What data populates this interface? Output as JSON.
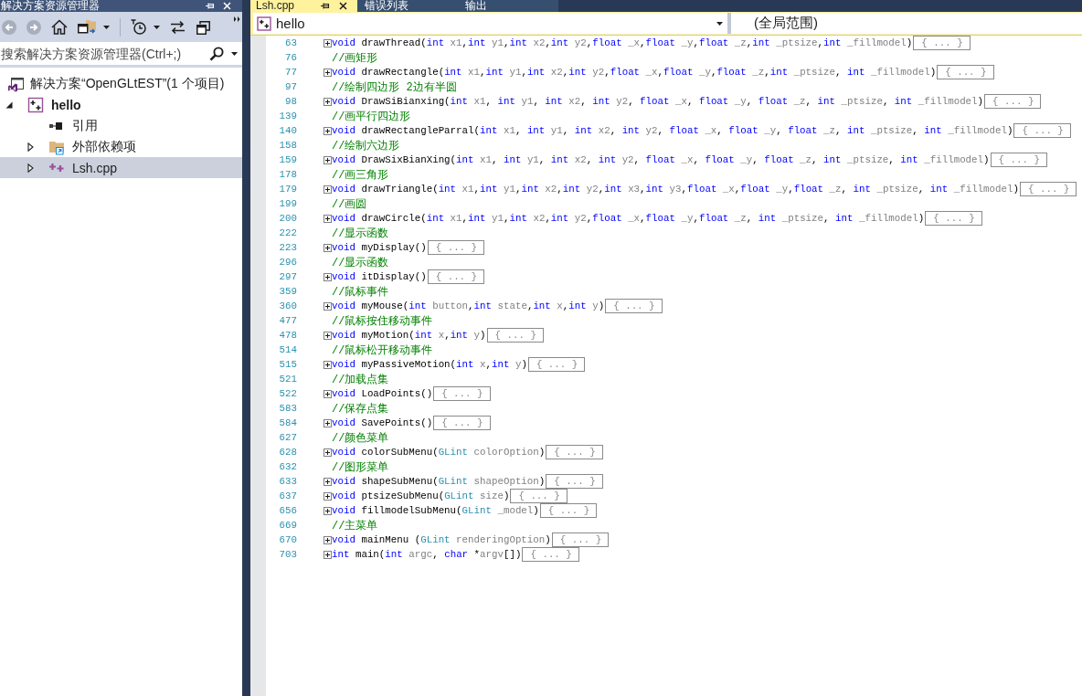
{
  "explorer": {
    "title": "解决方案资源管理器",
    "toolbar": [
      {
        "kind": "back",
        "disabled": true,
        "dropdown": false
      },
      {
        "kind": "forward",
        "disabled": true,
        "dropdown": false
      },
      {
        "kind": "home",
        "disabled": false,
        "dropdown": false
      },
      {
        "kind": "views",
        "disabled": false,
        "dropdown": true
      },
      {
        "kind": "separator"
      },
      {
        "kind": "history",
        "disabled": false,
        "dropdown": true
      },
      {
        "kind": "sync",
        "disabled": false,
        "dropdown": false
      },
      {
        "kind": "collapse",
        "disabled": false,
        "dropdown": false
      }
    ],
    "search": {
      "placeholder": "搜索解决方案资源管理器(Ctrl+;)"
    },
    "tree": [
      {
        "label": "解决方案“OpenGLtEST”(1 个项目)",
        "kind": "solution",
        "selected": false,
        "children": [
          {
            "label": "hello",
            "kind": "project",
            "startup": true,
            "expanded": true,
            "selected": false,
            "children": [
              {
                "label": "引用",
                "kind": "references",
                "selected": false
              },
              {
                "label": "外部依赖项",
                "kind": "dependencies",
                "expanded": false,
                "selected": false
              },
              {
                "label": "Lsh.cpp",
                "kind": "source",
                "expanded": false,
                "selected": true
              }
            ]
          }
        ]
      }
    ]
  },
  "editor": {
    "tabs": [
      {
        "label": "Lsh.cpp",
        "selected": true
      },
      {
        "label": "错误列表",
        "selected": false
      },
      {
        "label": "输出",
        "selected": false
      }
    ],
    "navigation": {
      "project": "hello",
      "scope": "(全局范围)"
    },
    "lines": [
      {
        "number": "63",
        "kind": "declaration",
        "expanded": false,
        "tokens": [
          {
            "kind": "keyword",
            "text": "void"
          },
          {
            "kind": "plain",
            "text": " drawThread("
          },
          {
            "kind": "keyword",
            "text": "int"
          },
          {
            "kind": "param",
            "text": " x1"
          },
          {
            "kind": "plain",
            "text": ","
          },
          {
            "kind": "keyword",
            "text": "int"
          },
          {
            "kind": "param",
            "text": " y1"
          },
          {
            "kind": "plain",
            "text": ","
          },
          {
            "kind": "keyword",
            "text": "int"
          },
          {
            "kind": "param",
            "text": " x2"
          },
          {
            "kind": "plain",
            "text": ","
          },
          {
            "kind": "keyword",
            "text": "int"
          },
          {
            "kind": "param",
            "text": " y2"
          },
          {
            "kind": "plain",
            "text": ","
          },
          {
            "kind": "keyword",
            "text": "float"
          },
          {
            "kind": "param",
            "text": " _x"
          },
          {
            "kind": "plain",
            "text": ","
          },
          {
            "kind": "keyword",
            "text": "float"
          },
          {
            "kind": "param",
            "text": " _y"
          },
          {
            "kind": "plain",
            "text": ","
          },
          {
            "kind": "keyword",
            "text": "float"
          },
          {
            "kind": "param",
            "text": " _z"
          },
          {
            "kind": "plain",
            "text": ","
          },
          {
            "kind": "keyword",
            "text": "int"
          },
          {
            "kind": "param",
            "text": " _ptsize"
          },
          {
            "kind": "plain",
            "text": ","
          },
          {
            "kind": "keyword",
            "text": "int"
          },
          {
            "kind": "param",
            "text": " _fillmodel"
          },
          {
            "kind": "plain",
            "text": ")"
          }
        ],
        "collapsed": "{ ... }"
      },
      {
        "number": "76",
        "kind": "comment",
        "text": "//画矩形"
      },
      {
        "number": "77",
        "kind": "declaration",
        "expanded": false,
        "tokens": [
          {
            "kind": "keyword",
            "text": "void"
          },
          {
            "kind": "plain",
            "text": " drawRectangle("
          },
          {
            "kind": "keyword",
            "text": "int"
          },
          {
            "kind": "param",
            "text": " x1"
          },
          {
            "kind": "plain",
            "text": ","
          },
          {
            "kind": "keyword",
            "text": "int"
          },
          {
            "kind": "param",
            "text": " y1"
          },
          {
            "kind": "plain",
            "text": ","
          },
          {
            "kind": "keyword",
            "text": "int"
          },
          {
            "kind": "param",
            "text": " x2"
          },
          {
            "kind": "plain",
            "text": ","
          },
          {
            "kind": "keyword",
            "text": "int"
          },
          {
            "kind": "param",
            "text": " y2"
          },
          {
            "kind": "plain",
            "text": ","
          },
          {
            "kind": "keyword",
            "text": "float"
          },
          {
            "kind": "param",
            "text": " _x"
          },
          {
            "kind": "plain",
            "text": ","
          },
          {
            "kind": "keyword",
            "text": "float"
          },
          {
            "kind": "param",
            "text": " _y"
          },
          {
            "kind": "plain",
            "text": ","
          },
          {
            "kind": "keyword",
            "text": "float"
          },
          {
            "kind": "param",
            "text": " _z"
          },
          {
            "kind": "plain",
            "text": ","
          },
          {
            "kind": "keyword",
            "text": "int"
          },
          {
            "kind": "param",
            "text": " _ptsize"
          },
          {
            "kind": "plain",
            "text": ", "
          },
          {
            "kind": "keyword",
            "text": "int"
          },
          {
            "kind": "param",
            "text": " _fillmodel"
          },
          {
            "kind": "plain",
            "text": ")"
          }
        ],
        "collapsed": "{ ... }"
      },
      {
        "number": "97",
        "kind": "comment",
        "text": "//绘制四边形 2边有半圆"
      },
      {
        "number": "98",
        "kind": "declaration",
        "expanded": false,
        "tokens": [
          {
            "kind": "keyword",
            "text": "void"
          },
          {
            "kind": "plain",
            "text": " DrawSiBianxing("
          },
          {
            "kind": "keyword",
            "text": "int"
          },
          {
            "kind": "param",
            "text": " x1"
          },
          {
            "kind": "plain",
            "text": ", "
          },
          {
            "kind": "keyword",
            "text": "int"
          },
          {
            "kind": "param",
            "text": " y1"
          },
          {
            "kind": "plain",
            "text": ", "
          },
          {
            "kind": "keyword",
            "text": "int"
          },
          {
            "kind": "param",
            "text": " x2"
          },
          {
            "kind": "plain",
            "text": ", "
          },
          {
            "kind": "keyword",
            "text": "int"
          },
          {
            "kind": "param",
            "text": " y2"
          },
          {
            "kind": "plain",
            "text": ", "
          },
          {
            "kind": "keyword",
            "text": "float"
          },
          {
            "kind": "param",
            "text": " _x"
          },
          {
            "kind": "plain",
            "text": ", "
          },
          {
            "kind": "keyword",
            "text": "float"
          },
          {
            "kind": "param",
            "text": " _y"
          },
          {
            "kind": "plain",
            "text": ", "
          },
          {
            "kind": "keyword",
            "text": "float"
          },
          {
            "kind": "param",
            "text": " _z"
          },
          {
            "kind": "plain",
            "text": ", "
          },
          {
            "kind": "keyword",
            "text": "int"
          },
          {
            "kind": "param",
            "text": " _ptsize"
          },
          {
            "kind": "plain",
            "text": ", "
          },
          {
            "kind": "keyword",
            "text": "int"
          },
          {
            "kind": "param",
            "text": " _fillmodel"
          },
          {
            "kind": "plain",
            "text": ")"
          }
        ],
        "collapsed": "{ ... }"
      },
      {
        "number": "139",
        "kind": "comment",
        "text": "//画平行四边形"
      },
      {
        "number": "140",
        "kind": "declaration",
        "expanded": false,
        "tokens": [
          {
            "kind": "keyword",
            "text": "void"
          },
          {
            "kind": "plain",
            "text": " drawRectangleParral("
          },
          {
            "kind": "keyword",
            "text": "int"
          },
          {
            "kind": "param",
            "text": " x1"
          },
          {
            "kind": "plain",
            "text": ", "
          },
          {
            "kind": "keyword",
            "text": "int"
          },
          {
            "kind": "param",
            "text": " y1"
          },
          {
            "kind": "plain",
            "text": ", "
          },
          {
            "kind": "keyword",
            "text": "int"
          },
          {
            "kind": "param",
            "text": " x2"
          },
          {
            "kind": "plain",
            "text": ", "
          },
          {
            "kind": "keyword",
            "text": "int"
          },
          {
            "kind": "param",
            "text": " y2"
          },
          {
            "kind": "plain",
            "text": ", "
          },
          {
            "kind": "keyword",
            "text": "float"
          },
          {
            "kind": "param",
            "text": " _x"
          },
          {
            "kind": "plain",
            "text": ", "
          },
          {
            "kind": "keyword",
            "text": "float"
          },
          {
            "kind": "param",
            "text": " _y"
          },
          {
            "kind": "plain",
            "text": ", "
          },
          {
            "kind": "keyword",
            "text": "float"
          },
          {
            "kind": "param",
            "text": " _z"
          },
          {
            "kind": "plain",
            "text": ", "
          },
          {
            "kind": "keyword",
            "text": "int"
          },
          {
            "kind": "param",
            "text": " _ptsize"
          },
          {
            "kind": "plain",
            "text": ", "
          },
          {
            "kind": "keyword",
            "text": "int"
          },
          {
            "kind": "param",
            "text": " _fillmodel"
          },
          {
            "kind": "plain",
            "text": ")"
          }
        ],
        "collapsed": "{ ... }"
      },
      {
        "number": "158",
        "kind": "comment",
        "text": "//绘制六边形"
      },
      {
        "number": "159",
        "kind": "declaration",
        "expanded": false,
        "tokens": [
          {
            "kind": "keyword",
            "text": "void"
          },
          {
            "kind": "plain",
            "text": " DrawSixBianXing("
          },
          {
            "kind": "keyword",
            "text": "int"
          },
          {
            "kind": "param",
            "text": " x1"
          },
          {
            "kind": "plain",
            "text": ", "
          },
          {
            "kind": "keyword",
            "text": "int"
          },
          {
            "kind": "param",
            "text": " y1"
          },
          {
            "kind": "plain",
            "text": ", "
          },
          {
            "kind": "keyword",
            "text": "int"
          },
          {
            "kind": "param",
            "text": " x2"
          },
          {
            "kind": "plain",
            "text": ", "
          },
          {
            "kind": "keyword",
            "text": "int"
          },
          {
            "kind": "param",
            "text": " y2"
          },
          {
            "kind": "plain",
            "text": ", "
          },
          {
            "kind": "keyword",
            "text": "float"
          },
          {
            "kind": "param",
            "text": " _x"
          },
          {
            "kind": "plain",
            "text": ", "
          },
          {
            "kind": "keyword",
            "text": "float"
          },
          {
            "kind": "param",
            "text": " _y"
          },
          {
            "kind": "plain",
            "text": ", "
          },
          {
            "kind": "keyword",
            "text": "float"
          },
          {
            "kind": "param",
            "text": " _z"
          },
          {
            "kind": "plain",
            "text": ", "
          },
          {
            "kind": "keyword",
            "text": "int"
          },
          {
            "kind": "param",
            "text": " _ptsize"
          },
          {
            "kind": "plain",
            "text": ", "
          },
          {
            "kind": "keyword",
            "text": "int"
          },
          {
            "kind": "param",
            "text": " _fillmodel"
          },
          {
            "kind": "plain",
            "text": ")"
          }
        ],
        "collapsed": "{ ... }"
      },
      {
        "number": "178",
        "kind": "comment",
        "text": "//画三角形"
      },
      {
        "number": "179",
        "kind": "declaration",
        "expanded": false,
        "tokens": [
          {
            "kind": "keyword",
            "text": "void"
          },
          {
            "kind": "plain",
            "text": " drawTriangle("
          },
          {
            "kind": "keyword",
            "text": "int"
          },
          {
            "kind": "param",
            "text": " x1"
          },
          {
            "kind": "plain",
            "text": ","
          },
          {
            "kind": "keyword",
            "text": "int"
          },
          {
            "kind": "param",
            "text": " y1"
          },
          {
            "kind": "plain",
            "text": ","
          },
          {
            "kind": "keyword",
            "text": "int"
          },
          {
            "kind": "param",
            "text": " x2"
          },
          {
            "kind": "plain",
            "text": ","
          },
          {
            "kind": "keyword",
            "text": "int"
          },
          {
            "kind": "param",
            "text": " y2"
          },
          {
            "kind": "plain",
            "text": ","
          },
          {
            "kind": "keyword",
            "text": "int"
          },
          {
            "kind": "param",
            "text": " x3"
          },
          {
            "kind": "plain",
            "text": ","
          },
          {
            "kind": "keyword",
            "text": "int"
          },
          {
            "kind": "param",
            "text": " y3"
          },
          {
            "kind": "plain",
            "text": ","
          },
          {
            "kind": "keyword",
            "text": "float"
          },
          {
            "kind": "param",
            "text": " _x"
          },
          {
            "kind": "plain",
            "text": ","
          },
          {
            "kind": "keyword",
            "text": "float"
          },
          {
            "kind": "param",
            "text": " _y"
          },
          {
            "kind": "plain",
            "text": ","
          },
          {
            "kind": "keyword",
            "text": "float"
          },
          {
            "kind": "param",
            "text": " _z"
          },
          {
            "kind": "plain",
            "text": ", "
          },
          {
            "kind": "keyword",
            "text": "int"
          },
          {
            "kind": "param",
            "text": " _ptsize"
          },
          {
            "kind": "plain",
            "text": ", "
          },
          {
            "kind": "keyword",
            "text": "int"
          },
          {
            "kind": "param",
            "text": " _fillmodel"
          },
          {
            "kind": "plain",
            "text": ")"
          }
        ],
        "collapsed": "{ ... }"
      },
      {
        "number": "199",
        "kind": "comment",
        "text": "//画圆"
      },
      {
        "number": "200",
        "kind": "declaration",
        "expanded": false,
        "tokens": [
          {
            "kind": "keyword",
            "text": "void"
          },
          {
            "kind": "plain",
            "text": " drawCircle("
          },
          {
            "kind": "keyword",
            "text": "int"
          },
          {
            "kind": "param",
            "text": " x1"
          },
          {
            "kind": "plain",
            "text": ","
          },
          {
            "kind": "keyword",
            "text": "int"
          },
          {
            "kind": "param",
            "text": " y1"
          },
          {
            "kind": "plain",
            "text": ","
          },
          {
            "kind": "keyword",
            "text": "int"
          },
          {
            "kind": "param",
            "text": " x2"
          },
          {
            "kind": "plain",
            "text": ","
          },
          {
            "kind": "keyword",
            "text": "int"
          },
          {
            "kind": "param",
            "text": " y2"
          },
          {
            "kind": "plain",
            "text": ","
          },
          {
            "kind": "keyword",
            "text": "float"
          },
          {
            "kind": "param",
            "text": " _x"
          },
          {
            "kind": "plain",
            "text": ","
          },
          {
            "kind": "keyword",
            "text": "float"
          },
          {
            "kind": "param",
            "text": " _y"
          },
          {
            "kind": "plain",
            "text": ","
          },
          {
            "kind": "keyword",
            "text": "float"
          },
          {
            "kind": "param",
            "text": " _z"
          },
          {
            "kind": "plain",
            "text": ", "
          },
          {
            "kind": "keyword",
            "text": "int"
          },
          {
            "kind": "param",
            "text": " _ptsize"
          },
          {
            "kind": "plain",
            "text": ", "
          },
          {
            "kind": "keyword",
            "text": "int"
          },
          {
            "kind": "param",
            "text": " _fillmodel"
          },
          {
            "kind": "plain",
            "text": ")"
          }
        ],
        "collapsed": "{ ... }"
      },
      {
        "number": "222",
        "kind": "comment",
        "text": "//显示函数"
      },
      {
        "number": "223",
        "kind": "declaration",
        "expanded": false,
        "tokens": [
          {
            "kind": "keyword",
            "text": "void"
          },
          {
            "kind": "plain",
            "text": " myDisplay()"
          }
        ],
        "collapsed": "{ ... }"
      },
      {
        "number": "296",
        "kind": "comment",
        "text": "//显示函数"
      },
      {
        "number": "297",
        "kind": "declaration",
        "expanded": false,
        "tokens": [
          {
            "kind": "keyword",
            "text": "void"
          },
          {
            "kind": "plain",
            "text": " itDisplay()"
          }
        ],
        "collapsed": "{ ... }"
      },
      {
        "number": "359",
        "kind": "comment",
        "text": "//鼠标事件"
      },
      {
        "number": "360",
        "kind": "declaration",
        "expanded": false,
        "tokens": [
          {
            "kind": "keyword",
            "text": "void"
          },
          {
            "kind": "plain",
            "text": " myMouse("
          },
          {
            "kind": "keyword",
            "text": "int"
          },
          {
            "kind": "param",
            "text": " button"
          },
          {
            "kind": "plain",
            "text": ","
          },
          {
            "kind": "keyword",
            "text": "int"
          },
          {
            "kind": "param",
            "text": " state"
          },
          {
            "kind": "plain",
            "text": ","
          },
          {
            "kind": "keyword",
            "text": "int"
          },
          {
            "kind": "param",
            "text": " x"
          },
          {
            "kind": "plain",
            "text": ","
          },
          {
            "kind": "keyword",
            "text": "int"
          },
          {
            "kind": "param",
            "text": " y"
          },
          {
            "kind": "plain",
            "text": ")"
          }
        ],
        "collapsed": "{ ... }"
      },
      {
        "number": "477",
        "kind": "comment",
        "text": "//鼠标按住移动事件"
      },
      {
        "number": "478",
        "kind": "declaration",
        "expanded": false,
        "tokens": [
          {
            "kind": "keyword",
            "text": "void"
          },
          {
            "kind": "plain",
            "text": " myMotion("
          },
          {
            "kind": "keyword",
            "text": "int"
          },
          {
            "kind": "param",
            "text": " x"
          },
          {
            "kind": "plain",
            "text": ","
          },
          {
            "kind": "keyword",
            "text": "int"
          },
          {
            "kind": "param",
            "text": " y"
          },
          {
            "kind": "plain",
            "text": ")"
          }
        ],
        "collapsed": "{ ... }"
      },
      {
        "number": "514",
        "kind": "comment",
        "text": "//鼠标松开移动事件"
      },
      {
        "number": "515",
        "kind": "declaration",
        "expanded": false,
        "tokens": [
          {
            "kind": "keyword",
            "text": "void"
          },
          {
            "kind": "plain",
            "text": " myPassiveMotion("
          },
          {
            "kind": "keyword",
            "text": "int"
          },
          {
            "kind": "param",
            "text": " x"
          },
          {
            "kind": "plain",
            "text": ","
          },
          {
            "kind": "keyword",
            "text": "int"
          },
          {
            "kind": "param",
            "text": " y"
          },
          {
            "kind": "plain",
            "text": ")"
          }
        ],
        "collapsed": "{ ... }"
      },
      {
        "number": "521",
        "kind": "comment",
        "text": "//加载点集"
      },
      {
        "number": "522",
        "kind": "declaration",
        "expanded": false,
        "tokens": [
          {
            "kind": "keyword",
            "text": "void"
          },
          {
            "kind": "plain",
            "text": " LoadPoints()"
          }
        ],
        "collapsed": "{ ... }"
      },
      {
        "number": "583",
        "kind": "comment",
        "text": "//保存点集"
      },
      {
        "number": "584",
        "kind": "declaration",
        "expanded": false,
        "tokens": [
          {
            "kind": "keyword",
            "text": "void"
          },
          {
            "kind": "plain",
            "text": " SavePoints()"
          }
        ],
        "collapsed": "{ ... }"
      },
      {
        "number": "627",
        "kind": "comment",
        "text": "//颜色菜单"
      },
      {
        "number": "628",
        "kind": "declaration",
        "expanded": false,
        "tokens": [
          {
            "kind": "keyword",
            "text": "void"
          },
          {
            "kind": "plain",
            "text": " colorSubMenu("
          },
          {
            "kind": "type",
            "text": "GLint"
          },
          {
            "kind": "param",
            "text": " colorOption"
          },
          {
            "kind": "plain",
            "text": ")"
          }
        ],
        "collapsed": "{ ... }"
      },
      {
        "number": "632",
        "kind": "comment",
        "text": "//图形菜单"
      },
      {
        "number": "633",
        "kind": "declaration",
        "expanded": false,
        "tokens": [
          {
            "kind": "keyword",
            "text": "void"
          },
          {
            "kind": "plain",
            "text": " shapeSubMenu("
          },
          {
            "kind": "type",
            "text": "GLint"
          },
          {
            "kind": "param",
            "text": " shapeOption"
          },
          {
            "kind": "plain",
            "text": ")"
          }
        ],
        "collapsed": "{ ... }"
      },
      {
        "number": "637",
        "kind": "declaration",
        "expanded": false,
        "tokens": [
          {
            "kind": "keyword",
            "text": "void"
          },
          {
            "kind": "plain",
            "text": " ptsizeSubMenu("
          },
          {
            "kind": "type",
            "text": "GLint"
          },
          {
            "kind": "param",
            "text": " size"
          },
          {
            "kind": "plain",
            "text": ")"
          }
        ],
        "collapsed": "{ ... }"
      },
      {
        "number": "656",
        "kind": "declaration",
        "expanded": false,
        "tokens": [
          {
            "kind": "keyword",
            "text": "void"
          },
          {
            "kind": "plain",
            "text": " fillmodelSubMenu("
          },
          {
            "kind": "type",
            "text": "GLint"
          },
          {
            "kind": "param",
            "text": " _model"
          },
          {
            "kind": "plain",
            "text": ")"
          }
        ],
        "collapsed": "{ ... }"
      },
      {
        "number": "669",
        "kind": "comment",
        "text": "//主菜单"
      },
      {
        "number": "670",
        "kind": "declaration",
        "expanded": false,
        "tokens": [
          {
            "kind": "keyword",
            "text": "void"
          },
          {
            "kind": "plain",
            "text": " mainMenu ("
          },
          {
            "kind": "type",
            "text": "GLint"
          },
          {
            "kind": "param",
            "text": " renderingOption"
          },
          {
            "kind": "plain",
            "text": ")"
          }
        ],
        "collapsed": "{ ... }"
      },
      {
        "number": "703",
        "kind": "declaration",
        "expanded": false,
        "tokens": [
          {
            "kind": "keyword",
            "text": "int"
          },
          {
            "kind": "plain",
            "text": " main("
          },
          {
            "kind": "keyword",
            "text": "int"
          },
          {
            "kind": "param",
            "text": " argc"
          },
          {
            "kind": "plain",
            "text": ", "
          },
          {
            "kind": "keyword",
            "text": "char"
          },
          {
            "kind": "plain",
            "text": " *"
          },
          {
            "kind": "param",
            "text": "argv"
          },
          {
            "kind": "plain",
            "text": "[])"
          }
        ],
        "collapsed": "{ ... }"
      }
    ]
  }
}
